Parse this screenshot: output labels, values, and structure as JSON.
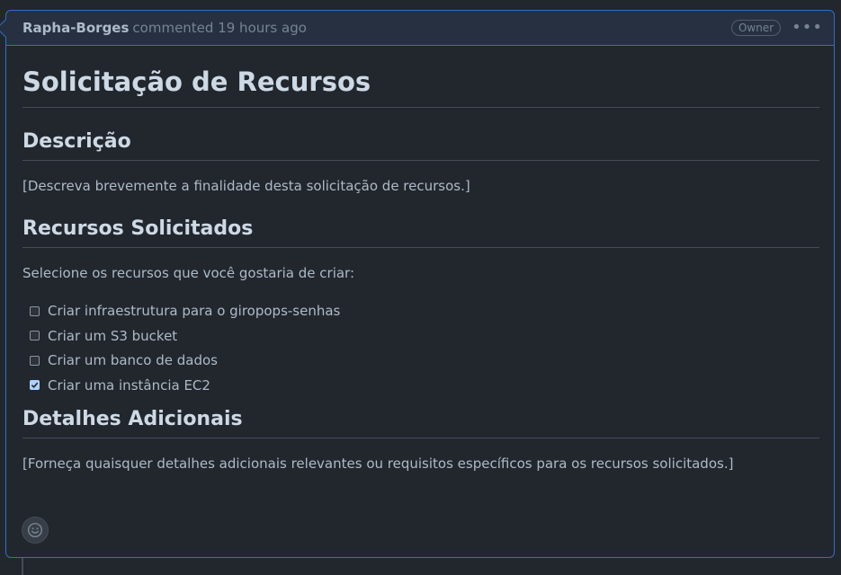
{
  "header": {
    "author": "Rapha-Borges",
    "meta": "commented 19 hours ago",
    "badge": "Owner"
  },
  "content": {
    "title": "Solicitação de Recursos",
    "section1": {
      "heading": "Descrição",
      "text": "[Descreva brevemente a finalidade desta solicitação de recursos.]"
    },
    "section2": {
      "heading": "Recursos Solicitados",
      "intro": "Selecione os recursos que você gostaria de criar:",
      "tasks": [
        {
          "label": "Criar infraestrutura para o giropops-senhas",
          "checked": false
        },
        {
          "label": "Criar um S3 bucket",
          "checked": false
        },
        {
          "label": "Criar um banco de dados",
          "checked": false
        },
        {
          "label": "Criar uma instância EC2",
          "checked": true
        }
      ]
    },
    "section3": {
      "heading": "Detalhes Adicionais",
      "text": "[Forneça quaisquer detalhes adicionais relevantes ou requisitos específicos para os recursos solicitados.]"
    }
  },
  "icons": {
    "menu": "kebab-horizontal-icon",
    "reaction": "smiley-icon"
  },
  "colors": {
    "accent_border": "#316dca",
    "background": "#22272e",
    "header_bg": "#263041",
    "checked": "#aed2ff"
  }
}
